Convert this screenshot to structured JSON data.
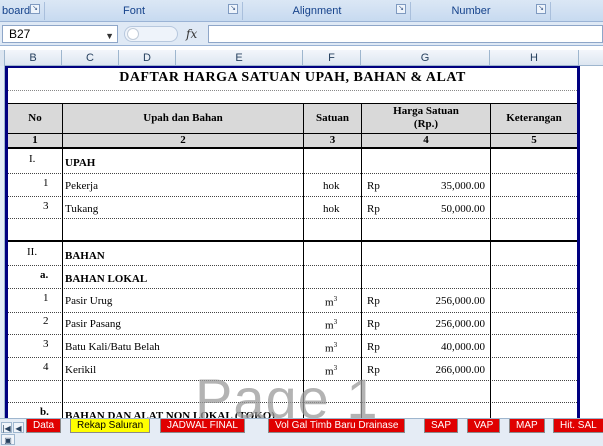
{
  "ribbon": {
    "groups": [
      "board",
      "Font",
      "Alignment",
      "Number"
    ]
  },
  "formula_bar": {
    "name_box": "B27",
    "fx_label": "fx",
    "formula": ""
  },
  "columns": [
    "B",
    "C",
    "D",
    "E",
    "F",
    "G",
    "H"
  ],
  "sheet": {
    "title": "DAFTAR HARGA SATUAN UPAH, BAHAN & ALAT",
    "headers": {
      "no": "No",
      "item": "Upah dan Bahan",
      "unit": "Satuan",
      "price_line1": "Harga Satuan",
      "price_line2": "(Rp.)",
      "note": "Keterangan"
    },
    "header_numbers": [
      "1",
      "2",
      "3",
      "4",
      "5"
    ],
    "sections": {
      "upah": {
        "num": "I.",
        "label": "UPAH"
      },
      "bahan": {
        "num": "II.",
        "label": "BAHAN"
      },
      "lokal": {
        "num": "a.",
        "label": "BAHAN LOKAL"
      },
      "nonlokal": {
        "num": "b.",
        "label": "BAHAN DAN ALAT NON LOKAL (TOKO)"
      }
    },
    "upah_rows": [
      {
        "no": "1",
        "name": "Pekerja",
        "unit": "hok",
        "cur": "Rp",
        "price": "35,000.00"
      },
      {
        "no": "3",
        "name": "Tukang",
        "unit": "hok",
        "cur": "Rp",
        "price": "50,000.00"
      }
    ],
    "bahan_rows": [
      {
        "no": "1",
        "name": "Pasir Urug",
        "unit": "m",
        "sup": "3",
        "cur": "Rp",
        "price": "256,000.00"
      },
      {
        "no": "2",
        "name": "Pasir Pasang",
        "unit": "m",
        "sup": "3",
        "cur": "Rp",
        "price": "256,000.00"
      },
      {
        "no": "3",
        "name": "Batu Kali/Batu Belah",
        "unit": "m",
        "sup": "3",
        "cur": "Rp",
        "price": "40,000.00"
      },
      {
        "no": "4",
        "name": "Kerikil",
        "unit": "m",
        "sup": "3",
        "cur": "Rp",
        "price": "266,000.00"
      }
    ],
    "watermark": "Page 1"
  },
  "tabs": [
    {
      "label": "Data"
    },
    {
      "label": "Rekap Saluran",
      "active": true
    },
    {
      "label": "JADWAL FINAL"
    },
    {
      "label": "Vol Gal Timb Baru Drainase"
    },
    {
      "label": "SAP"
    },
    {
      "label": "VAP"
    },
    {
      "label": "MAP"
    },
    {
      "label": "Hit. SAL"
    }
  ],
  "colors": {
    "frame": "#000080",
    "tab_red": "#e00000",
    "tab_active": "#ffff00"
  }
}
